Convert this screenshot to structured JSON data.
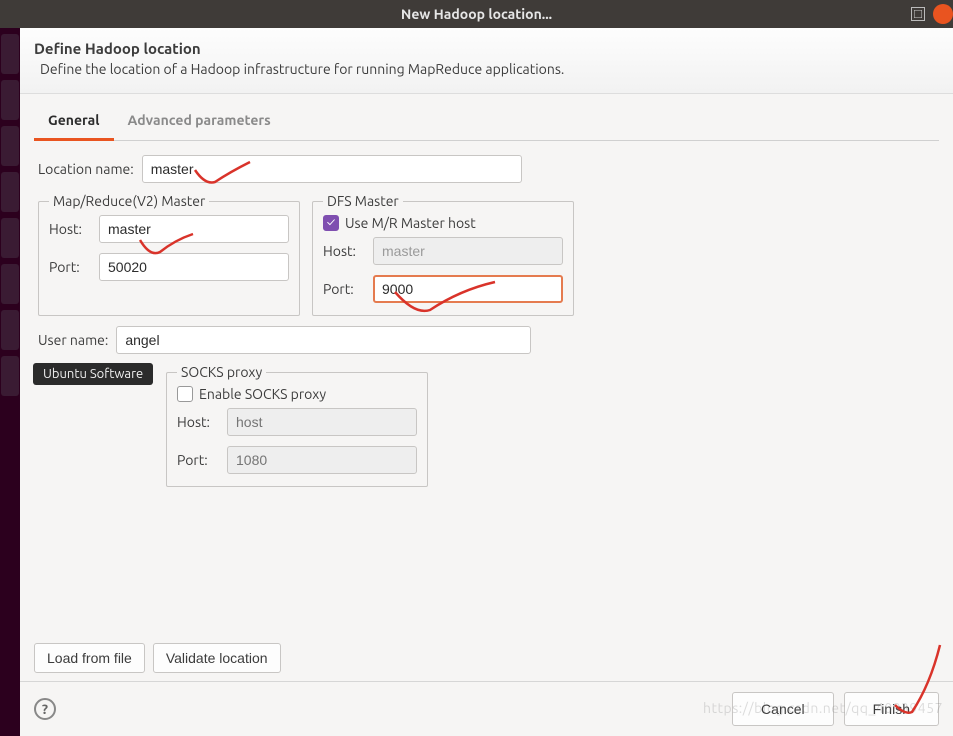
{
  "window": {
    "title": "New Hadoop location..."
  },
  "banner": {
    "heading": "Define Hadoop location",
    "desc": "Define the location of a Hadoop infrastructure for running MapReduce applications."
  },
  "tabs": {
    "general": "General",
    "advanced": "Advanced parameters"
  },
  "form": {
    "location_label": "Location name:",
    "location_value": "master",
    "mr_group": "Map/Reduce(V2) Master",
    "host_label": "Host:",
    "mr_host_value": "master",
    "port_label": "Port:",
    "mr_port_value": "50020",
    "dfs_group": "DFS Master",
    "use_mr_label": "Use M/R Master host",
    "use_mr_checked": true,
    "dfs_host_value": "master",
    "dfs_port_value": "9000",
    "user_label": "User name:",
    "user_value": "angel",
    "socks_group": "SOCKS proxy",
    "enable_socks_label": "Enable SOCKS proxy",
    "enable_socks_checked": false,
    "socks_host_placeholder": "host",
    "socks_port_placeholder": "1080"
  },
  "buttons": {
    "load": "Load from file",
    "validate": "Validate location",
    "cancel": "Cancel",
    "finish": "Finish"
  },
  "tooltip": "Ubuntu Software",
  "watermark": "https://blog.csdn.net/qq_40939457"
}
